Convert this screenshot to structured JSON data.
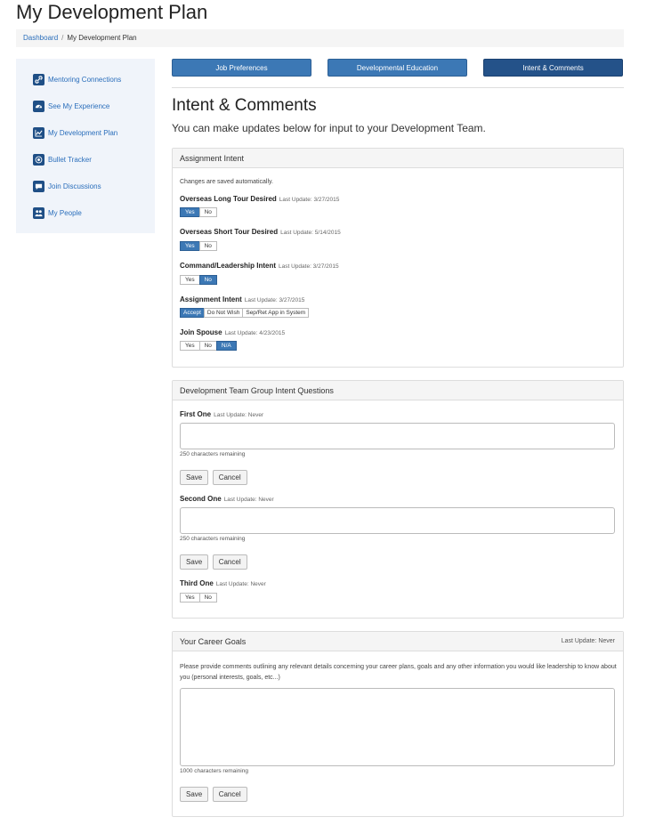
{
  "page": {
    "title": "My Development Plan"
  },
  "breadcrumb": {
    "home": "Dashboard",
    "separator": "/",
    "current": "My Development Plan"
  },
  "sidebar": {
    "items": [
      {
        "label": "Mentoring Connections",
        "icon": "link-icon",
        "glyph": "🔗"
      },
      {
        "label": "See My Experience",
        "icon": "dashboard-icon",
        "glyph": "◒"
      },
      {
        "label": "My Development Plan",
        "icon": "chart-icon",
        "glyph": "📈"
      },
      {
        "label": "Bullet Tracker",
        "icon": "target-icon",
        "glyph": "◎"
      },
      {
        "label": "Join Discussions",
        "icon": "chat-icon",
        "glyph": "💬"
      },
      {
        "label": "My People",
        "icon": "people-icon",
        "glyph": "👥"
      }
    ]
  },
  "tabs": [
    {
      "label": "Job Preferences"
    },
    {
      "label": "Developmental Education"
    },
    {
      "label": "Intent & Comments"
    }
  ],
  "main": {
    "title": "Intent & Comments",
    "subtitle": "You can make updates below for input to your Development Team."
  },
  "assignment": {
    "heading": "Assignment Intent",
    "note": "Changes are saved automatically.",
    "q1": {
      "label": "Overseas Long Tour Desired",
      "update": "Last Update: 3/27/2015",
      "options": [
        "Yes",
        "No"
      ],
      "selected": "Yes"
    },
    "q2": {
      "label": "Overseas Short Tour Desired",
      "update": "Last Update: 5/14/2015",
      "options": [
        "Yes",
        "No"
      ],
      "selected": "Yes"
    },
    "q3": {
      "label": "Command/Leadership Intent",
      "update": "Last Update: 3/27/2015",
      "options": [
        "Yes",
        "No"
      ],
      "selected": "No"
    },
    "q4": {
      "label": "Assignment Intent",
      "update": "Last Update: 3/27/2015",
      "options": [
        "Accept",
        "Do Not Wish",
        "Sep/Ret App in System"
      ],
      "selected": "Accept"
    },
    "q5": {
      "label": "Join Spouse",
      "update": "Last Update: 4/23/2015",
      "options": [
        "Yes",
        "No",
        "N/A"
      ],
      "selected": "N/A"
    }
  },
  "group": {
    "heading": "Development Team Group Intent Questions",
    "first": {
      "label": "First One",
      "update": "Last Update: Never",
      "value": "",
      "remaining": "250 characters remaining"
    },
    "second": {
      "label": "Second One",
      "update": "Last Update: Never",
      "value": "",
      "remaining": "250 characters remaining"
    },
    "third": {
      "label": "Third One",
      "update": "Last Update: Never",
      "options": [
        "Yes",
        "No"
      ]
    },
    "save": "Save",
    "cancel": "Cancel"
  },
  "career": {
    "heading": "Your Career Goals",
    "update": "Last Update: Never",
    "description": "Please provide comments outlining any relevant details concerning your career plans, goals and any other information you would like leadership to know about you (personal interests, goals, etc...)",
    "value": "",
    "remaining": "1000 characters remaining",
    "save": "Save",
    "cancel": "Cancel"
  },
  "colors": {
    "primary": "#3c78b5",
    "primary_dark": "#245289",
    "link": "#2a6ebb",
    "sidebar_bg": "#f0f4fa"
  }
}
